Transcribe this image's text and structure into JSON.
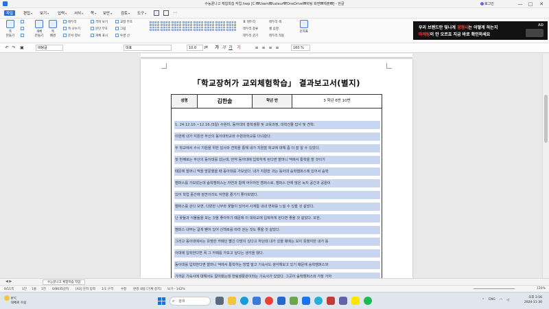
{
  "window": {
    "title": "수능끝나고 체험학습 작업.hwp [C:₩Users₩cateur₩OneDrive₩바탕 화면₩제출₩] - 한글",
    "user": "로그인",
    "controls": [
      "—",
      "□",
      "✕"
    ]
  },
  "menu": {
    "items": [
      {
        "label": "파일"
      },
      {
        "label": "편집"
      },
      {
        "label": "보기"
      },
      {
        "label": "입력"
      },
      {
        "label": "서식"
      },
      {
        "label": "쪽"
      },
      {
        "label": "보안"
      },
      {
        "label": "검토"
      },
      {
        "label": "도구"
      }
    ]
  },
  "ribbon": {
    "big_buttons": [
      {
        "label": "쪽\n만들기"
      },
      {
        "label": "개체\n만들기"
      },
      {
        "label": "쪽\n배경"
      }
    ],
    "checks": [
      "테두리",
      "쪽 나누기",
      "문서 정보",
      "격자 보기",
      "문단 부호",
      "개체 표시",
      "교정 부호",
      "그림",
      "투명 선",
      "메모",
      "조판 부호",
      "화면 확대"
    ],
    "right_items": [
      "표 테두리",
      "테두리 종류",
      "테두리 굵기",
      "테두리 색",
      "셀 음영",
      "테두리 적용"
    ],
    "extra": "문자표"
  },
  "ad": {
    "line1_pre": "우리 브랜드만 빛나게 ",
    "line1_hl": "경쟁사",
    "line1_post": "는 어떻게 하는지",
    "line2_hl": "마케팅",
    "line2_post": "이 안 오르죠",
    "line2b": " 지금 바로 확인하세요",
    "logo": "AD"
  },
  "format_bar": {
    "style": "바탕글",
    "font": "대표",
    "size": "10.0",
    "unit": "pt",
    "line_spacing": "160 %"
  },
  "document": {
    "title": "「학교장허가 교외체험학습」 결과보고서(별지)",
    "info": {
      "name_label": "성명",
      "name_value": "김한솔",
      "grade_label": "학년 반",
      "grade_value": "3  학년    6반  10번"
    },
    "lines": [
      "1. 24.12.10.~12.16.(5일) 수원미, 동아대의 홍학생활 및 교육과정, 대학건물 답사 및 견학:",
      "이번에 내가 지원한 부산의 동아대학교와 수원대학교를 다녀왔다.",
      "두 학교에서 수시 지원을 위한 답사와 견학을 통해 내가 지원할 학교에 대해 좀 더 잘 알 수 있었다.",
      "첫 번째로는 부산의 동아대를 갔는데, 만약 동아대에 입학하게 된다면 할머니 댁에서 통학을 할 것이기",
      "때문에 할머니 댁을 방문했을 때 동아대를 가보았다. 내가 지원한 과는 동아대 승학캠퍼스에 있어서 승학",
      "캠퍼스를 가보았는데 승학캠퍼스는 자연과 함께 어우러진 캠퍼스로, 캠퍼스 안에 많은 녹지 공간과 공원이",
      "있어 학업 중간에 잠깐이라도 자연을 즐기기 좋아보였다.",
      "캠퍼스를 걷다 보면, 다양한 나무와 꽃들이 있어서 사계절 내내 변화를 느낄 수 있을 것 같았다.",
      "난 꽃들과 식물들을 보는 것을 좋아하기 때문에 이 대학교에 입학하게 된다면 좋을 것 같았다. 또한,",
      "캠퍼스 내부는 걸게 뻗어 있어 산책로를 따라 걷는 것도 좋을 것 같았다.",
      "그리고 동아대에서는 유명한 카페인 빨간 다방이 있다고 하던데 내가 갔을 때에는 보지 못했지만 내가 동",
      "아대에 입학한다면 꼭 그 카페를 가보고 싶다는 생각을 했다.",
      " 동아대를 입학한다면 할머니 댁에서 통학하는 방법 말고 기숙사도 생각해보고 있기 때문에 승학캠퍼스와",
      "가까운 기숙사에 대해서도 알아봤는데 한림생활관이라는 기숙사가 있었다. 그곳이 승학캠퍼스와 가장 가까"
    ]
  },
  "sheet_tabs": {
    "nav": "◀ ▶",
    "active": "수능끝나고 체험학습 작업"
  },
  "status": {
    "page": "9/11쪽",
    "section": "1단",
    "line": "1줄",
    "col": "1칸",
    "chars": "0/8035글자",
    "lang": "[A3] 문자 입력",
    "layout": "1/1 구역",
    "mode": "수정",
    "change": "변경 내용 [기록 중지]",
    "zoom_label": "보기 - 142%",
    "zoom": "120%"
  },
  "taskbar": {
    "weather_temp": "8°C",
    "weather_desc": "대체로 흐림",
    "search": "검색",
    "lang": "ENG",
    "time": "오후 3:56",
    "date": "2024-11-30"
  },
  "colors": {
    "selection": "#c9d6f0",
    "accent": "#1e6fd9",
    "ad_highlight": "#ff3b3b"
  }
}
